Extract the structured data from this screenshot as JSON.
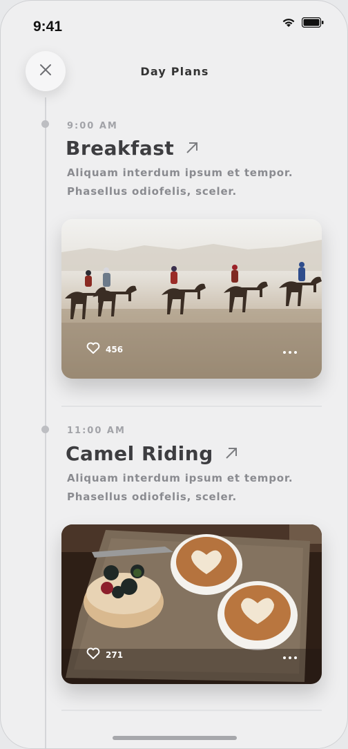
{
  "status": {
    "time": "9:41"
  },
  "header": {
    "title": "Day Plans"
  },
  "entries": [
    {
      "time": "9:00 AM",
      "title": "Breakfast",
      "desc_line1": "Aliquam interdum ipsum et tempor.",
      "desc_line2": "Phasellus odiofelis, sceler.",
      "likes": "456"
    },
    {
      "time": "11:00 AM",
      "title": "Camel Riding",
      "desc_line1": "Aliquam interdum ipsum et tempor.",
      "desc_line2": "Phasellus odiofelis, sceler.",
      "likes": "271"
    }
  ],
  "icons": {
    "close": "close-icon",
    "arrow": "arrow-up-right-icon",
    "heart": "heart-icon",
    "more": "more-horizontal-icon",
    "wifi": "wifi-icon",
    "battery": "battery-icon"
  },
  "colors": {
    "background": "#efeff0",
    "title": "#3d3d40",
    "time": "#a2a3a8",
    "description": "#8a8b90"
  }
}
